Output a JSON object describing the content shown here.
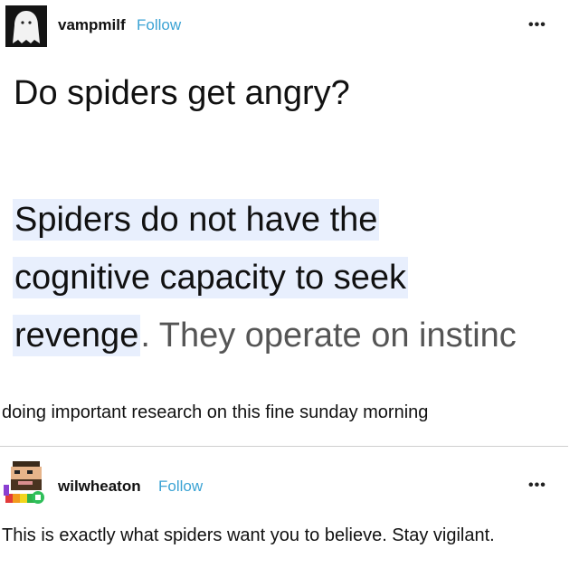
{
  "post": {
    "author": "vampmilf",
    "follow_label": "Follow",
    "more_label": "•••",
    "avatar_icon": "ghost-icon",
    "question": "Do spiders get angry?",
    "snippet_line1": "Spiders do not have the",
    "snippet_line2": "cognitive capacity to seek",
    "snippet_line3_bold": "revenge",
    "snippet_line3_rest": ". They operate on instinc",
    "caption": "doing important research on this fine sunday morning"
  },
  "reply": {
    "author": "wilwheaton",
    "follow_label": "Follow",
    "more_label": "•••",
    "avatar_icon": "pixel-portrait-icon",
    "text": "This is exactly what spiders want you to believe. Stay vigilant."
  }
}
